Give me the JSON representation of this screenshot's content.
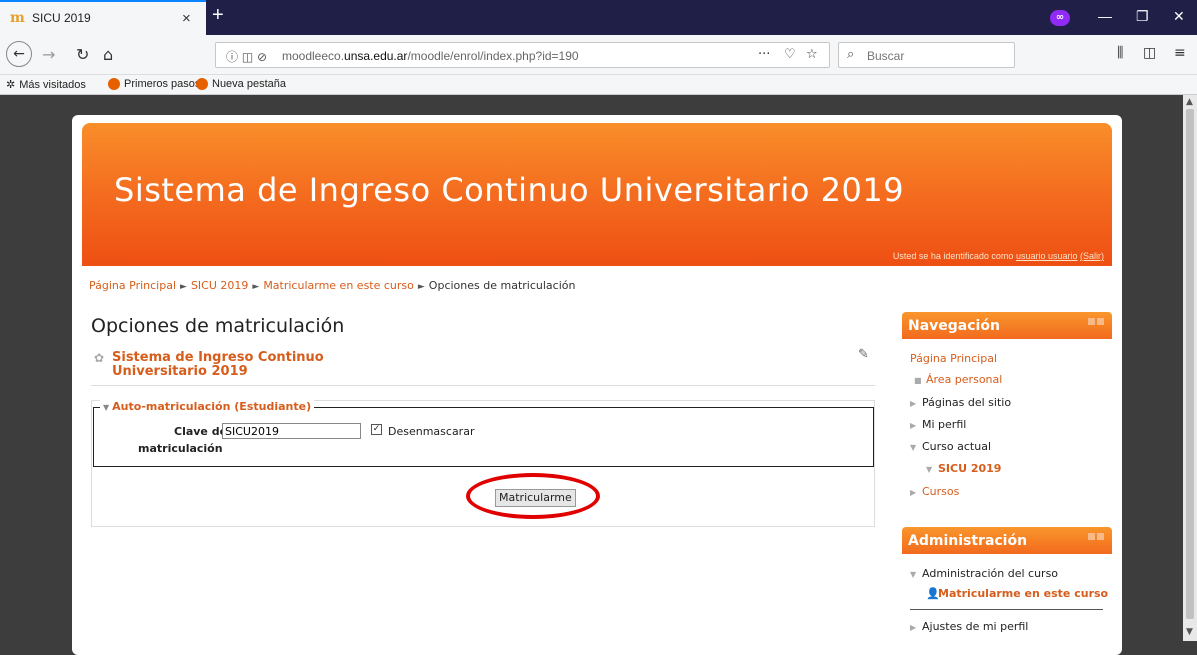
{
  "browser": {
    "tab_title": "SICU 2019",
    "tab_close": "×",
    "new_tab": "+",
    "url_prefix": "moodleeco.",
    "url_domain": "unsa.edu.ar",
    "url_path": "/moodle/enrol/index.php?id=190",
    "search_placeholder": "Buscar",
    "page_actions": "···",
    "bookmarks": [
      "Más visitados",
      "Primeros pasos",
      "Nueva pestaña"
    ]
  },
  "header": {
    "site_title": "Sistema de Ingreso Continuo Universitario 2019",
    "login_prefix": "Usted se ha identificado como",
    "login_user": "usuario usuario",
    "logout": "(Salir)"
  },
  "breadcrumb": [
    "Página Principal",
    "SICU 2019",
    "Matricularme en este curso",
    "Opciones de matriculación"
  ],
  "main": {
    "heading": "Opciones de matriculación",
    "course_name": "Sistema de Ingreso Continuo Universitario 2019",
    "legend": "Auto-matriculación (Estudiante)",
    "key_label_1": "Clave de",
    "key_label_2": "matriculación",
    "key_value": "SICU2019",
    "unmask_label": "Desenmascarar",
    "submit": "Matricularme"
  },
  "navigation": {
    "title": "Navegación",
    "home": "Página Principal",
    "items": [
      "Área personal",
      "Páginas del sitio",
      "Mi perfil",
      "Curso actual",
      "SICU 2019",
      "Cursos"
    ]
  },
  "administration": {
    "title": "Administración",
    "items": [
      "Administración del curso",
      "Matricularme en este curso",
      "Ajustes de mi perfil"
    ]
  },
  "colors": {
    "accent": "#d65d1b",
    "banner": "#f46c1f",
    "highlight": "#e00000"
  }
}
